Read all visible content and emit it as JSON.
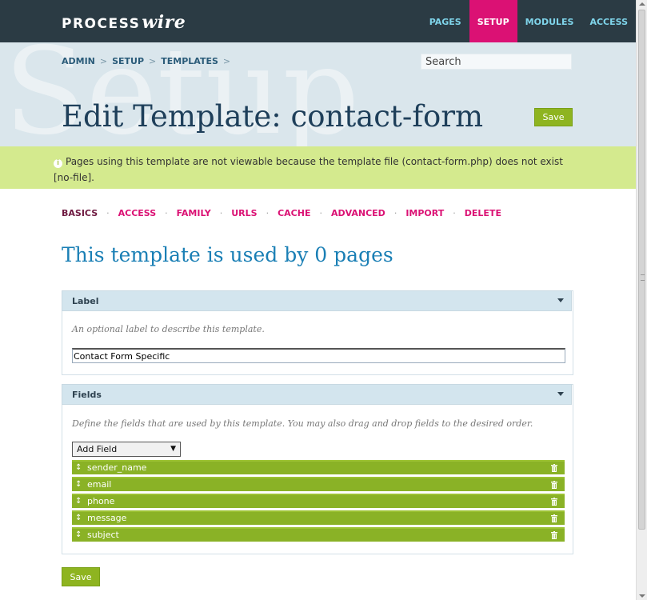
{
  "masthead": {
    "logo_part1": "PROCESS",
    "logo_part2": "wire",
    "nav": [
      {
        "label": "PAGES",
        "active": false
      },
      {
        "label": "SETUP",
        "active": true
      },
      {
        "label": "MODULES",
        "active": false
      },
      {
        "label": "ACCESS",
        "active": false
      }
    ]
  },
  "header": {
    "watermark": "Setup",
    "breadcrumb": [
      "ADMIN",
      "SETUP",
      "TEMPLATES"
    ],
    "breadcrumb_sep": ">",
    "search_placeholder": "Search",
    "title": "Edit Template: contact-form",
    "save_label": "Save"
  },
  "notice": {
    "text": "Pages using this template are not viewable because the template file (contact-form.php) does not exist [no-file]."
  },
  "tabs": [
    {
      "label": "BASICS",
      "active": true
    },
    {
      "label": "ACCESS",
      "active": false
    },
    {
      "label": "FAMILY",
      "active": false
    },
    {
      "label": "URLS",
      "active": false
    },
    {
      "label": "CACHE",
      "active": false
    },
    {
      "label": "ADVANCED",
      "active": false
    },
    {
      "label": "IMPORT",
      "active": false
    },
    {
      "label": "DELETE",
      "active": false
    }
  ],
  "tab_separator": "·",
  "usage_text": "This template is used by 0 pages",
  "label_panel": {
    "title": "Label",
    "description": "An optional label to describe this template.",
    "value": "Contact Form Specific"
  },
  "fields_panel": {
    "title": "Fields",
    "description": "Define the fields that are used by this template. You may also drag and drop fields to the desired order.",
    "add_field_label": "Add Field",
    "fields": [
      "sender_name",
      "email",
      "phone",
      "message",
      "subject"
    ]
  },
  "footer": {
    "save_label": "Save"
  },
  "colors": {
    "masthead": "#2b3b44",
    "accent": "#db1174",
    "header_bg": "#dae6ec",
    "notice_bg": "#d4ea8e",
    "button_green": "#8eb420",
    "field_green": "#8ab226",
    "title": "#1e3f5a",
    "usage": "#1a7fb5"
  }
}
